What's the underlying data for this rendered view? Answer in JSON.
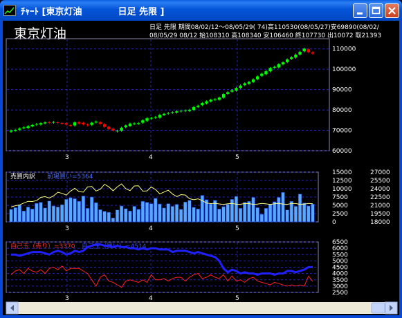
{
  "window": {
    "title": "ﾁｬｰﾄ [東京灯油　　　　日足 先限 ]",
    "buttons": [
      "minimize",
      "maximize",
      "close"
    ]
  },
  "header": {
    "name_box": "東京灯油",
    "line1": "日足 先限 期間08/02/12〜08/05/29( 74)高110530(08/05/27)安69890(08/02/",
    "line2": "08/05/29 08/12 始108310 高108340 安106460 終107730 出10072 取21393"
  },
  "colors": {
    "up": "#00ff00",
    "down": "#ff0000",
    "grid": "#2828a8",
    "axis_text": "#ffffff",
    "volume": "#58a8ff",
    "oi_line": "#ffff80",
    "sell_line": "#ff2020",
    "buy_line": "#2020ff"
  },
  "price_chart": {
    "y_labels": [
      "110000",
      "100000",
      "90000",
      "80000",
      "70000",
      "60000"
    ],
    "x_labels": [
      "3",
      "4",
      "5"
    ]
  },
  "volume_chart": {
    "label": "売買内訳",
    "sublabel": "前場買い=5364",
    "left_labels": [
      "15000",
      "12500",
      "10000",
      "7500",
      "5000",
      "2500",
      "0"
    ],
    "right_labels": [
      "27000",
      "25500",
      "24000",
      "22500",
      "21000",
      "19500",
      "18000"
    ],
    "x_labels": [
      "3",
      "4",
      "5"
    ]
  },
  "position_chart": {
    "sell_label": "自己玉（売り）=3370",
    "buy_label": "自己玉（買い）=4514",
    "y_labels": [
      "6500",
      "6000",
      "5500",
      "5000",
      "4500",
      "4000",
      "3500",
      "3000",
      "2500"
    ],
    "x_labels": [
      "3",
      "4",
      "5"
    ]
  },
  "chart_data": [
    {
      "type": "candlestick",
      "title": "東京灯油",
      "ylim": [
        60000,
        115000
      ],
      "x_ticks": [
        "3",
        "4",
        "5"
      ],
      "close": [
        69900,
        70200,
        70900,
        71400,
        72000,
        72600,
        73100,
        73500,
        73900,
        73800,
        74100,
        73600,
        73300,
        72800,
        72500,
        73900,
        73400,
        73000,
        72700,
        73700,
        74300,
        73200,
        71700,
        70600,
        69900,
        69800,
        71300,
        72400,
        73300,
        73400,
        73500,
        74900,
        75900,
        76100,
        76500,
        77600,
        78100,
        78500,
        78900,
        79400,
        79600,
        79800,
        80100,
        81400,
        82100,
        83400,
        84200,
        85000,
        85300,
        86100,
        87800,
        88700,
        89700,
        90800,
        92000,
        93100,
        93800,
        95000,
        96500,
        97800,
        99000,
        100600,
        101200,
        102500,
        103400,
        104800,
        105900,
        107200,
        108600,
        110100,
        108400,
        107700
      ]
    },
    {
      "type": "bar",
      "title": "売買内訳",
      "series": [
        {
          "name": "前場買い",
          "values": [
            3800,
            4300,
            5100,
            3300,
            4500,
            3900,
            5600,
            5900,
            4200,
            6300,
            4800,
            4500,
            5200,
            6800,
            7300,
            7000,
            6200,
            7800,
            4100,
            7500,
            5800,
            3700,
            3200,
            2900,
            1200,
            3600,
            4800,
            4000,
            3300,
            4700,
            3800,
            6200,
            5900,
            5500,
            7100,
            5400,
            4200,
            5500,
            4700,
            5300,
            3800,
            6000,
            6500,
            4400,
            3900,
            8000,
            6700,
            5400,
            6500,
            3900,
            4600,
            5300,
            6800,
            7700,
            4100,
            5900,
            6200,
            7400,
            4300,
            2300,
            4100,
            5300,
            6100,
            7400,
            8900,
            3600,
            6200,
            4700,
            8400,
            5700,
            4800,
            5364
          ]
        }
      ],
      "ylim": [
        0,
        15000
      ]
    },
    {
      "type": "line",
      "title": "自己玉",
      "series": [
        {
          "name": "自己玉（売り）",
          "values": [
            3900,
            4200,
            4300,
            4000,
            4400,
            4200,
            4100,
            4300,
            4000,
            4400,
            4500,
            4300,
            4600,
            4200,
            4400,
            4400,
            4400,
            4200,
            4000,
            3500,
            3000,
            3700,
            3900,
            3400,
            3300,
            3100,
            2900,
            3400,
            3500,
            3400,
            3300,
            3500,
            3300,
            3900,
            3500,
            3500,
            3600,
            3400,
            3600,
            3700,
            3700,
            3400,
            3700,
            3900,
            4000,
            3600,
            3700,
            3900,
            3700,
            3600,
            3900,
            3400,
            3800,
            3400,
            3500,
            3300,
            3600,
            3700,
            3400,
            3300,
            3200,
            3100,
            3300,
            3200,
            3100,
            3000,
            3100,
            3000,
            3100,
            3000,
            3800,
            3370
          ]
        },
        {
          "name": "自己玉（買い）",
          "values": [
            5500,
            5500,
            5400,
            5500,
            5600,
            5700,
            5700,
            5700,
            5600,
            5500,
            5700,
            5800,
            5700,
            5500,
            5600,
            5800,
            5700,
            5800,
            6100,
            6200,
            6300,
            6300,
            6200,
            6200,
            6100,
            6200,
            6100,
            6100,
            6000,
            6000,
            5900,
            6000,
            5900,
            6000,
            6000,
            5900,
            5900,
            5900,
            5700,
            5800,
            5800,
            5800,
            5700,
            5600,
            5700,
            5600,
            5500,
            5400,
            5300,
            5000,
            4400,
            4100,
            4300,
            4200,
            4000,
            4100,
            4000,
            4000,
            3900,
            4000,
            4000,
            4000,
            3900,
            4000,
            4000,
            4200,
            4200,
            4100,
            4200,
            4300,
            4500,
            4514
          ]
        }
      ],
      "ylim": [
        2500,
        6500
      ]
    }
  ]
}
